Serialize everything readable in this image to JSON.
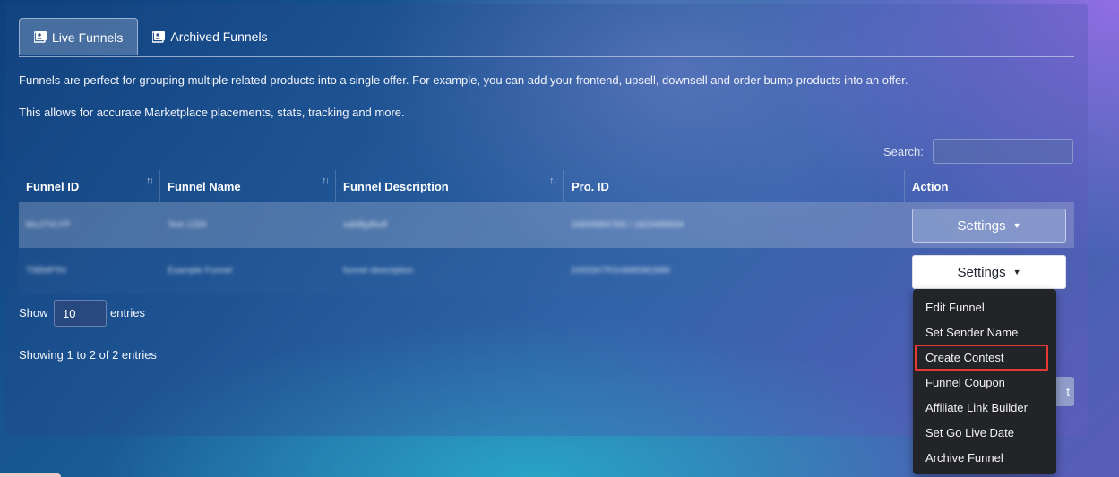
{
  "tabs": [
    {
      "label": "Live Funnels",
      "icon": "id-card-icon",
      "active": true
    },
    {
      "label": "Archived Funnels",
      "icon": "id-card-icon",
      "active": false
    }
  ],
  "intro": {
    "line1": "Funnels are perfect for grouping multiple related products into a single offer. For example, you can add your frontend, upsell, downsell and order bump products into an offer.",
    "line2": "This allows for accurate Marketplace placements, stats, tracking and more."
  },
  "search": {
    "label": "Search:",
    "value": ""
  },
  "table": {
    "columns": [
      "Funnel ID",
      "Funnel Name",
      "Funnel Description",
      "Pro. ID",
      "Action"
    ],
    "rows": [
      {
        "id": "MuJ7VLYP",
        "name": "Test 1333",
        "description": "safdfgdfsdf",
        "pro_id": "1683398478S / 1823489934",
        "action": "Settings"
      },
      {
        "id": "T5BMP9V",
        "name": "Example Funnel",
        "description": "funnel description",
        "pro_id": "2493347RS/4885982886",
        "action": "Settings"
      }
    ]
  },
  "length": {
    "show": "Show",
    "value": "10",
    "entries": "entries"
  },
  "info": "Showing 1 to 2 of 2 entries",
  "pagination": {
    "next_fragment": "t"
  },
  "dropdown": {
    "items": [
      "Edit Funnel",
      "Set Sender Name",
      "Create Contest",
      "Funnel Coupon",
      "Affiliate Link Builder",
      "Set Go Live Date",
      "Archive Funnel"
    ],
    "highlighted": "Create Contest"
  },
  "colors": {
    "highlight": "#e53935",
    "menu_bg": "#222428"
  }
}
